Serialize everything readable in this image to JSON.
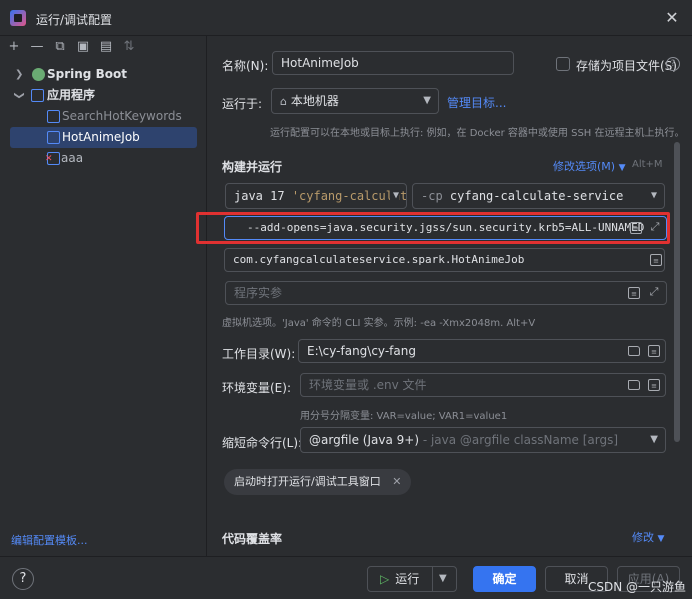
{
  "window": {
    "title": "运行/调试配置",
    "close": "✕"
  },
  "toolbar": {
    "add": "+",
    "remove": "—",
    "copy": "⧉",
    "save": "▣",
    "folder": "▤",
    "sort": "⇅"
  },
  "tree": {
    "spring_boot": "Spring Boot",
    "application": "应用程序",
    "items": [
      "SearchHotKeywords",
      "HotAnimeJob",
      "aaa"
    ]
  },
  "edit_templates": "编辑配置模板...",
  "form": {
    "name_label": "名称(N):",
    "name_value": "HotAnimeJob",
    "store_as_file": "存储为项目文件(S)",
    "run_on_label": "运行于:",
    "run_on_value": "本地机器",
    "manage_targets": "管理目标...",
    "run_on_hint": "运行配置可以在本地或目标上执行: 例如，在 Docker 容器中或使用 SSH 在远程主机上执行。",
    "build_run": "构建并运行",
    "modify_options": "修改选项(M)",
    "modify_shortcut": "Alt+M",
    "jdk_value": "java 17",
    "jdk_module": "'cyfang-calculat",
    "cp_prefix": "-cp",
    "cp_value": "cyfang-calculate-service",
    "vm_options": "--add-opens=java.security.jgss/sun.security.krb5=ALL-UNNAMED",
    "main_class": "com.cyfangcalculateservice.spark.HotAnimeJob",
    "program_args_placeholder": "程序实参",
    "vm_hint": "虚拟机选项。'Java' 命令的 CLI 实参。示例: -ea -Xmx2048m. Alt+V",
    "workdir_label": "工作目录(W):",
    "workdir_value": "E:\\cy-fang\\cy-fang",
    "env_label": "环境变量(E):",
    "env_placeholder": "环境变量或 .env 文件",
    "env_hint": "用分号分隔变量: VAR=value; VAR1=value1",
    "shorten_label": "缩短命令行(L):",
    "shorten_value": "@argfile (Java 9+)",
    "shorten_desc": "- java @argfile className [args]",
    "chip_label": "启动时打开运行/调试工具窗口",
    "coverage": "代码覆盖率",
    "coverage_modify": "修改"
  },
  "footer": {
    "help": "?",
    "run": "运行",
    "ok": "确定",
    "cancel": "取消",
    "apply": "应用(A)"
  },
  "watermark": "CSDN @一只游鱼",
  "colors": {
    "accent": "#3574f0",
    "highlight": "#e03131",
    "background": "#2b2d30"
  }
}
